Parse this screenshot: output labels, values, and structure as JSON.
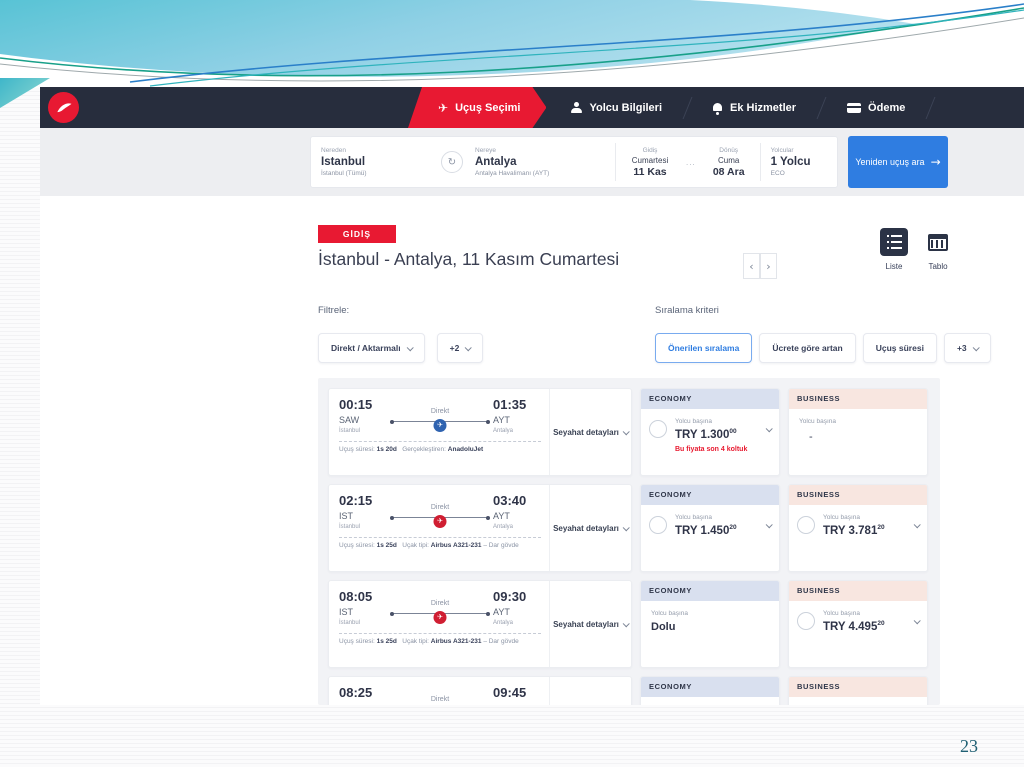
{
  "page_number": "23",
  "nav": {
    "steps": [
      {
        "label": "Uçuş Seçimi"
      },
      {
        "label": "Yolcu Bilgileri"
      },
      {
        "label": "Ek Hizmetler"
      },
      {
        "label": "Ödeme"
      }
    ]
  },
  "search": {
    "from_label": "Nereden",
    "from_city": "Istanbul",
    "from_detail": "İstanbul (Tümü)",
    "to_label": "Nereye",
    "to_city": "Antalya",
    "to_detail": "Antalya Havalimanı (AYT)",
    "dep_label": "Gidiş",
    "dep_day": "Cumartesi",
    "dep_date": "11 Kas",
    "ret_label": "Dönüş",
    "ret_day": "Cuma",
    "ret_date": "08 Ara",
    "pax_label": "Yolcular",
    "pax_count": "1 Yolcu",
    "pax_class": "ECO",
    "search_button": "Yeniden uçuş ara"
  },
  "results_header": {
    "direction_badge": "GİDİŞ",
    "title": "İstanbul - Antalya, 11 Kasım Cumartesi",
    "view_list_label": "Liste",
    "view_table_label": "Tablo"
  },
  "filters": {
    "filter_label": "Filtrele:",
    "filter_type": "Direkt / Aktarmalı",
    "filter_more": "+2",
    "sort_label": "Sıralama kriteri",
    "sort_recommended": "Önerilen sıralama",
    "sort_price": "Ücrete göre artan",
    "sort_duration": "Uçuş süresi",
    "sort_more": "+3"
  },
  "cabin": {
    "economy": "ECONOMY",
    "business": "BUSINESS",
    "per_passenger": "Yolcu başına"
  },
  "flights": [
    {
      "dep_time": "00:15",
      "dep_code": "SAW",
      "dep_city": "İstanbul",
      "arr_time": "01:35",
      "arr_code": "AYT",
      "arr_city": "Antalya",
      "stops": "Direkt",
      "duration_label": "Uçuş süresi:",
      "duration": "1s 20d",
      "info_label": "Gerçekleştiren:",
      "info_value": "AnadoluJet",
      "info_suffix": "",
      "details_link": "Seyahat detayları",
      "economy_price": "TRY 1.300",
      "economy_decimals": "00",
      "economy_note": "Bu fiyata son 4 koltuk",
      "business_price": "-"
    },
    {
      "dep_time": "02:15",
      "dep_code": "IST",
      "dep_city": "İstanbul",
      "arr_time": "03:40",
      "arr_code": "AYT",
      "arr_city": "Antalya",
      "stops": "Direkt",
      "duration_label": "Uçuş süresi:",
      "duration": "1s 25d",
      "info_label": "Uçak tipi:",
      "info_value": "Airbus A321-231",
      "info_suffix": "– Dar gövde",
      "details_link": "Seyahat detayları",
      "economy_price": "TRY 1.450",
      "economy_decimals": "20",
      "business_price": "TRY 3.781",
      "business_decimals": "20"
    },
    {
      "dep_time": "08:05",
      "dep_code": "IST",
      "dep_city": "İstanbul",
      "arr_time": "09:30",
      "arr_code": "AYT",
      "arr_city": "Antalya",
      "stops": "Direkt",
      "duration_label": "Uçuş süresi:",
      "duration": "1s 25d",
      "info_label": "Uçak tipi:",
      "info_value": "Airbus A321-231",
      "info_suffix": "– Dar gövde",
      "details_link": "Seyahat detayları",
      "economy_full": "Dolu",
      "business_price": "TRY 4.495",
      "business_decimals": "20"
    },
    {
      "dep_time": "08:25",
      "arr_time": "09:45",
      "stops": "Direkt"
    }
  ]
}
